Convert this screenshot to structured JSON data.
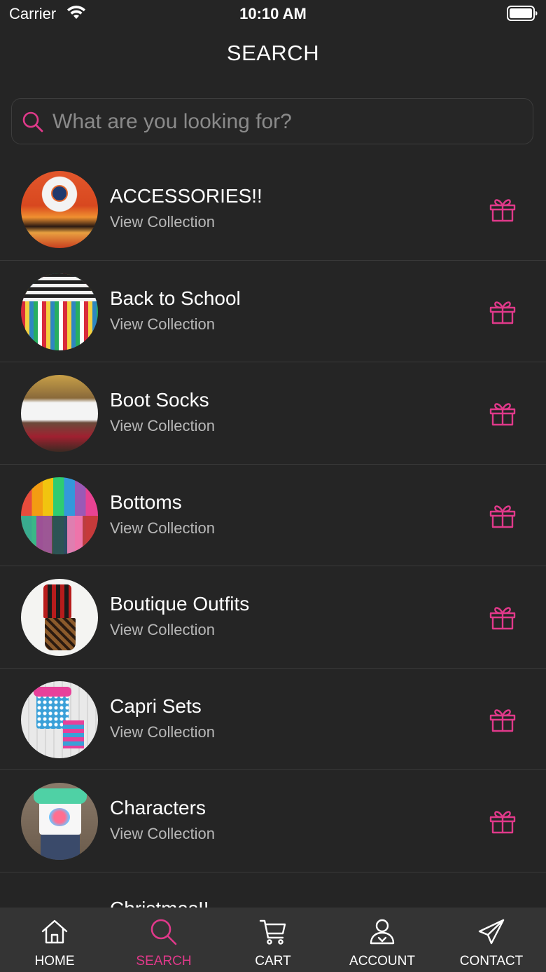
{
  "status_bar": {
    "carrier": "Carrier",
    "time": "10:10 AM"
  },
  "header": {
    "title": "SEARCH"
  },
  "search": {
    "placeholder": "What are you looking for?",
    "value": ""
  },
  "colors": {
    "background": "#252525",
    "accent": "#e0398a",
    "tab_bar": "#343434",
    "subtitle": "#b8b8b8",
    "divider": "#3a3a3a"
  },
  "collections": [
    {
      "title": "ACCESSORIES!!",
      "subtitle": "View Collection",
      "icon": "gift-icon"
    },
    {
      "title": "Back to School",
      "subtitle": "View Collection",
      "icon": "gift-icon"
    },
    {
      "title": "Boot Socks",
      "subtitle": "View Collection",
      "icon": "gift-icon"
    },
    {
      "title": "Bottoms",
      "subtitle": "View Collection",
      "icon": "gift-icon"
    },
    {
      "title": "Boutique Outfits",
      "subtitle": "View Collection",
      "icon": "gift-icon"
    },
    {
      "title": "Capri Sets",
      "subtitle": "View Collection",
      "icon": "gift-icon"
    },
    {
      "title": "Characters",
      "subtitle": "View Collection",
      "icon": "gift-icon"
    },
    {
      "title": "Christmas!!",
      "subtitle": "",
      "icon": "gift-icon"
    }
  ],
  "tab_bar": {
    "items": [
      {
        "label": "HOME",
        "icon": "home-icon"
      },
      {
        "label": "SEARCH",
        "icon": "search-icon",
        "active": true
      },
      {
        "label": "CART",
        "icon": "cart-icon"
      },
      {
        "label": "ACCOUNT",
        "icon": "account-icon"
      },
      {
        "label": "CONTACT",
        "icon": "paper-plane-icon"
      }
    ]
  }
}
